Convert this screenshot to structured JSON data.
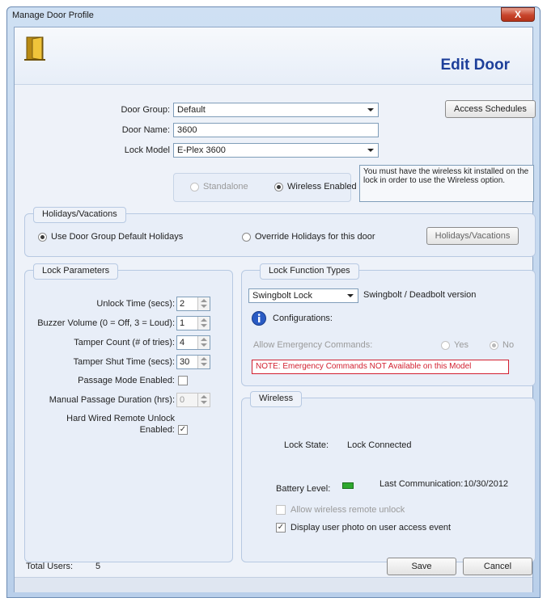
{
  "window": {
    "title": "Manage Door Profile",
    "close_label": "X"
  },
  "header": {
    "heading": "Edit Door",
    "icon": "door-icon"
  },
  "door": {
    "group_label": "Door Group:",
    "group_value": "Default",
    "name_label": "Door Name:",
    "name_value": "3600",
    "model_label": "Lock Model",
    "model_value": "E-Plex 3600"
  },
  "access_schedules_button": "Access Schedules",
  "wireless_note": "You must have the wireless kit installed on the lock in order to use the Wireless option.",
  "mode": {
    "standalone_label": "Standalone",
    "wireless_label": "Wireless Enabled",
    "selected": "wireless"
  },
  "holidays": {
    "title": "Holidays/Vacations",
    "use_default_label": "Use Door Group Default Holidays",
    "override_label": "Override Holidays for this door",
    "button_label": "Holidays/Vacations",
    "selected": "use_default"
  },
  "lock_params": {
    "title": "Lock Parameters",
    "unlock_time_label": "Unlock Time (secs):",
    "unlock_time_value": "2",
    "buzzer_label": "Buzzer Volume (0 = Off, 3 = Loud):",
    "buzzer_value": "1",
    "tamper_count_label": "Tamper Count (# of tries):",
    "tamper_count_value": "4",
    "tamper_shut_label": "Tamper Shut Time (secs):",
    "tamper_shut_value": "30",
    "passage_mode_label": "Passage Mode Enabled:",
    "passage_mode_checked": false,
    "manual_passage_label": "Manual Passage Duration (hrs):",
    "manual_passage_value": "0",
    "hard_wired_label_1": "Hard Wired Remote Unlock",
    "hard_wired_label_2": "Enabled:",
    "hard_wired_checked": true
  },
  "lock_function": {
    "title": "Lock Function Types",
    "type_value": "Swingbolt Lock",
    "type_desc": "Swingbolt / Deadbolt version",
    "info_icon": "info-icon",
    "configurations_label": "Configurations:",
    "emergency_label": "Allow Emergency Commands:",
    "yes_label": "Yes",
    "no_label": "No",
    "emergency_selected": "no",
    "note": "NOTE: Emergency Commands NOT Available on this Model"
  },
  "wireless": {
    "title": "Wireless",
    "lock_state_label": "Lock State:",
    "lock_state_value": "Lock Connected",
    "battery_label": "Battery Level:",
    "battery_color": "#2ea82e",
    "last_comm_label": "Last Communication:",
    "last_comm_value": "10/30/2012",
    "allow_remote_label": "Allow wireless remote unlock",
    "allow_remote_checked": false,
    "display_photo_label": "Display user photo on user access event",
    "display_photo_checked": true
  },
  "footer": {
    "total_users_label": "Total Users:",
    "total_users_value": "5",
    "save_label": "Save",
    "cancel_label": "Cancel"
  },
  "colors": {
    "heading": "#1d3f9a",
    "note_red": "#d21f2f",
    "accent_border": "#b7c9e2"
  }
}
